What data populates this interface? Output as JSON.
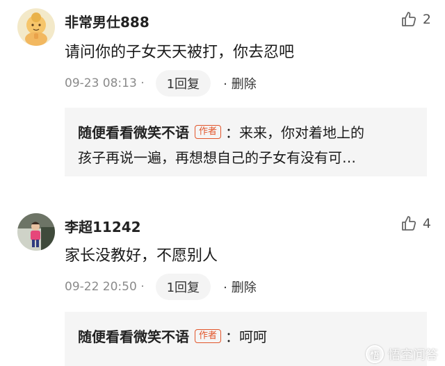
{
  "comments": [
    {
      "username": "非常男仕888",
      "likes": "2",
      "text": "请问你的子女天天被打，你去忍吧",
      "time": "09-23 08:13",
      "time_sep": "·",
      "reply_count_label": "1回复",
      "delete_label": "删除",
      "delete_dot": "·",
      "reply": {
        "author": "随便看看微笑不语",
        "tag": "作者",
        "line1": "：来来，你对着地上的",
        "line2": "孩子再说一遍，再想想自己的子女有没有可…"
      }
    },
    {
      "username": "李超11242",
      "likes": "4",
      "text": "家长没教好，不愿别人",
      "time": "09-22 20:50",
      "time_sep": "·",
      "reply_count_label": "1回复",
      "delete_label": "删除",
      "delete_dot": "·",
      "reply": {
        "author": "随便看看微笑不语",
        "tag": "作者",
        "line1": "：呵呵"
      }
    }
  ],
  "watermark": {
    "logo_glyph": "悟",
    "text": "悟空问答"
  },
  "colors": {
    "author_tag": "#e2552a",
    "reply_bg": "#f5f5f5",
    "meta_gray": "#8a8a8a"
  },
  "icons": {
    "like": "thumbs-up-icon"
  }
}
